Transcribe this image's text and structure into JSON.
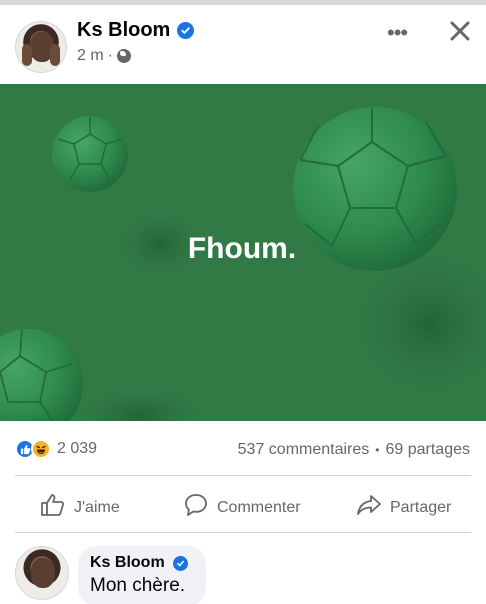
{
  "post": {
    "author": "Ks Bloom",
    "time": "2 m",
    "separator": "·",
    "image_text": "Fhoum."
  },
  "stats": {
    "reaction_count": "2 039",
    "comments": "537 commentaires",
    "separator": "•",
    "shares": "69 partages"
  },
  "actions": {
    "like": "J'aime",
    "comment": "Commenter",
    "share": "Partager"
  },
  "comment": {
    "author": "Ks Bloom",
    "text": "Mon chère."
  },
  "colors": {
    "brand_blue": "#1b74e4",
    "image_green": "#317a46",
    "ball_green": "#2f8a4e",
    "muted_text": "#65676b"
  },
  "icons": [
    "verified-icon",
    "globe-icon",
    "more-icon",
    "close-icon",
    "like-reaction-icon",
    "haha-reaction-icon",
    "thumbs-up-icon",
    "comment-icon",
    "share-icon"
  ]
}
